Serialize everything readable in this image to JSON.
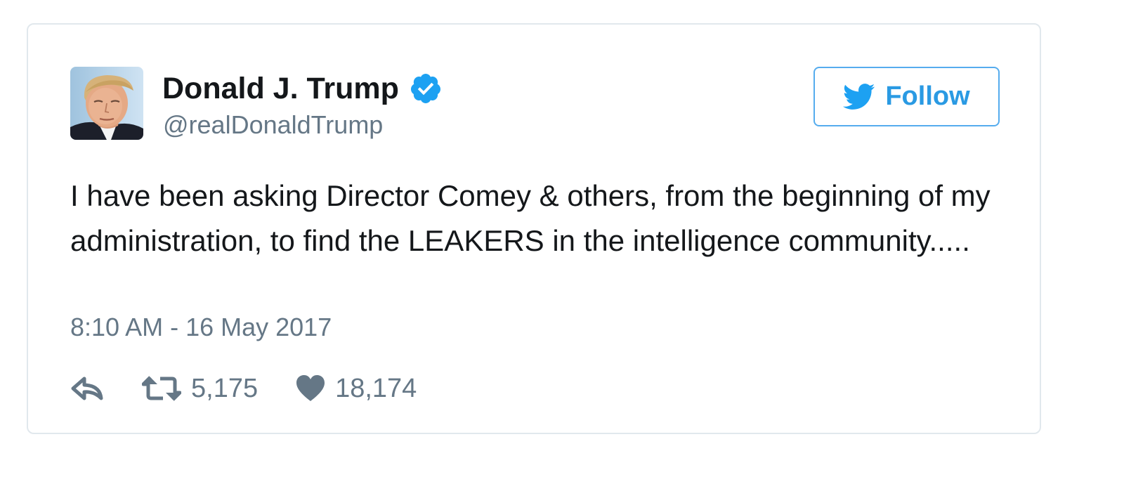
{
  "user": {
    "display_name": "Donald J. Trump",
    "handle": "@realDonaldTrump",
    "verified": true,
    "avatar_icon": "profile-photo"
  },
  "follow_button": {
    "label": "Follow",
    "icon": "twitter-bird-icon"
  },
  "tweet": {
    "text": "I have been asking Director Comey & others, from the beginning of my administration, to find the LEAKERS in the intelligence community.....",
    "timestamp": "8:10 AM - 16 May 2017"
  },
  "actions": {
    "reply_icon": "reply-icon",
    "retweet_icon": "retweet-icon",
    "retweet_count": "5,175",
    "like_icon": "heart-icon",
    "like_count": "18,174"
  },
  "colors": {
    "accent": "#1da1f2",
    "follow_border": "#55acee",
    "secondary_text": "#657786",
    "card_border": "#e1e8ed"
  }
}
